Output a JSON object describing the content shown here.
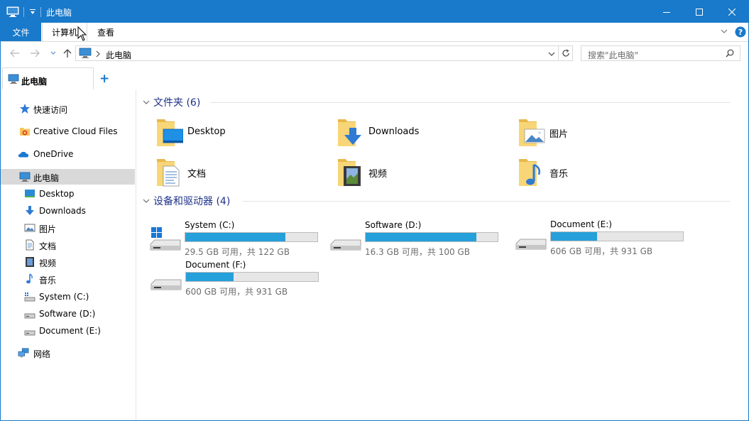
{
  "window": {
    "title": "此电脑",
    "accent": "#1979ca"
  },
  "ribbon": {
    "tabs": [
      {
        "label": "文件"
      },
      {
        "label": "计算机"
      },
      {
        "label": "查看"
      }
    ]
  },
  "address": {
    "crumb": "此电脑",
    "search_placeholder": "搜索\"此电脑\""
  },
  "tab": {
    "label": "此电脑",
    "add": "+"
  },
  "sidebar": {
    "items": [
      {
        "label": "快速访问",
        "icon": "star-icon"
      },
      {
        "label": "Creative Cloud Files",
        "icon": "creative-cloud-folder-icon"
      },
      {
        "label": "OneDrive",
        "icon": "cloud-icon"
      },
      {
        "label": "此电脑",
        "icon": "computer-icon"
      },
      {
        "label": "Desktop",
        "icon": "desktop-icon"
      },
      {
        "label": "Downloads",
        "icon": "download-icon"
      },
      {
        "label": "图片",
        "icon": "pictures-icon"
      },
      {
        "label": "文档",
        "icon": "documents-icon"
      },
      {
        "label": "视频",
        "icon": "videos-icon"
      },
      {
        "label": "音乐",
        "icon": "music-icon"
      },
      {
        "label": "System (C:)",
        "icon": "drive-icon"
      },
      {
        "label": "Software (D:)",
        "icon": "drive-icon"
      },
      {
        "label": "Document (E:)",
        "icon": "drive-icon"
      },
      {
        "label": "网络",
        "icon": "network-icon"
      }
    ]
  },
  "main": {
    "folders_group": "文件夹 (6)",
    "folders": [
      {
        "name": "Desktop"
      },
      {
        "name": "Downloads"
      },
      {
        "name": "图片"
      },
      {
        "name": "文档"
      },
      {
        "name": "视频"
      },
      {
        "name": "音乐"
      }
    ],
    "drives_group": "设备和驱动器 (4)",
    "drives": [
      {
        "name": "System (C:)",
        "free": "29.5 GB 可用，共 122 GB",
        "used_fraction": 0.76
      },
      {
        "name": "Software (D:)",
        "free": "16.3 GB 可用，共 100 GB",
        "used_fraction": 0.84
      },
      {
        "name": "Document (E:)",
        "free": "606 GB 可用，共 931 GB",
        "used_fraction": 0.35
      },
      {
        "name": "Document (F:)",
        "free": "600 GB 可用，共 931 GB",
        "used_fraction": 0.36
      }
    ]
  }
}
